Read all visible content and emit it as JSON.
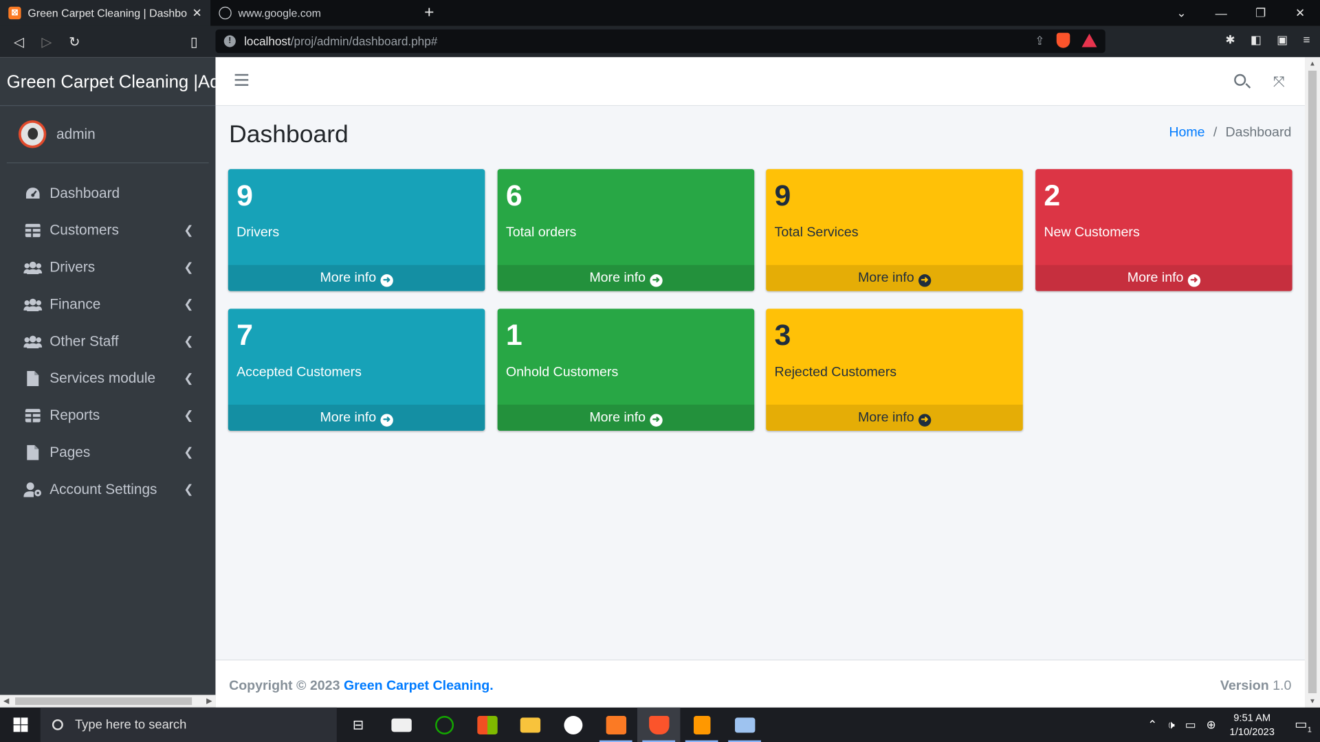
{
  "browser": {
    "tabs": [
      {
        "title": "Green Carpet Cleaning | Dashboard",
        "active": true
      },
      {
        "title": "www.google.com",
        "active": false
      }
    ],
    "url_host": "localhost",
    "url_path": "/proj/admin/dashboard.php#"
  },
  "sidebar": {
    "brand": "Green Carpet Cleaning |Admin",
    "user": "admin",
    "items": [
      {
        "label": "Dashboard",
        "icon": "tachometer-icon",
        "has_children": false
      },
      {
        "label": "Customers",
        "icon": "table-icon",
        "has_children": true
      },
      {
        "label": "Drivers",
        "icon": "users-icon",
        "has_children": true
      },
      {
        "label": "Finance",
        "icon": "users-icon",
        "has_children": true
      },
      {
        "label": "Other Staff",
        "icon": "users-icon",
        "has_children": true
      },
      {
        "label": "Services module",
        "icon": "file-icon",
        "has_children": true
      },
      {
        "label": "Reports",
        "icon": "table-icon",
        "has_children": true
      },
      {
        "label": "Pages",
        "icon": "file-icon",
        "has_children": true
      },
      {
        "label": "Account Settings",
        "icon": "user-cog-icon",
        "has_children": true
      }
    ]
  },
  "header": {
    "title": "Dashboard",
    "breadcrumb": {
      "home": "Home",
      "current": "Dashboard"
    }
  },
  "boxes": [
    {
      "value": "9",
      "label": "Drivers",
      "link": "More info",
      "color": "info"
    },
    {
      "value": "6",
      "label": "Total orders",
      "link": "More info",
      "color": "success"
    },
    {
      "value": "9",
      "label": "Total Services",
      "link": "More info",
      "color": "warning"
    },
    {
      "value": "2",
      "label": "New Customers",
      "link": "More info",
      "color": "danger"
    },
    {
      "value": "7",
      "label": "Accepted Customers",
      "link": "More info",
      "color": "info"
    },
    {
      "value": "1",
      "label": "Onhold Customers",
      "link": "More info",
      "color": "success"
    },
    {
      "value": "3",
      "label": "Rejected Customers",
      "link": "More info",
      "color": "warning"
    }
  ],
  "colors": {
    "info": "#17a2b8",
    "success": "#28a745",
    "warning": "#ffc107",
    "danger": "#dc3545"
  },
  "footer": {
    "copyright": "Copyright © 2023",
    "company": "Green Carpet Cleaning.",
    "version_label": "Version",
    "version": "1.0"
  },
  "taskbar": {
    "search_placeholder": "Type here to search",
    "time": "9:51 AM",
    "date": "1/10/2023",
    "notification_count": "1"
  }
}
